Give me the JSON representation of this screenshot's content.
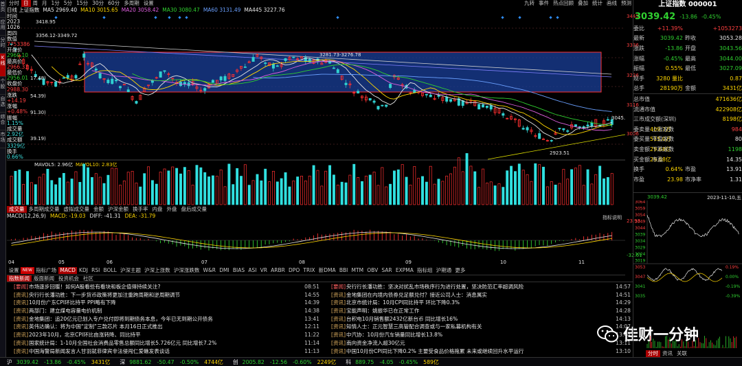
{
  "sidebar": [
    "首页",
    "应用",
    "分时",
    "K线",
    "个股",
    "自选",
    "综合",
    "市场"
  ],
  "topbar": [
    "分时",
    "日",
    "周",
    "月",
    "1分",
    "5分",
    "15分",
    "30分",
    "60分",
    "多周期",
    "设置"
  ],
  "topbar_right": [
    "九转",
    "事件",
    "热点回顾",
    "叠加",
    "统计",
    "画线",
    "预测"
  ],
  "chart_info": {
    "title": "日线 上证指数",
    "ma5": "MA5 2969.40",
    "ma10": "MA10 3015.65",
    "ma20": "MA20 3058.42",
    "ma30": "MA30 3080.47",
    "ma60": "MA60 3131.49",
    "ma445": "MA445 3227.76"
  },
  "left_info": [
    {
      "t": "时间",
      "c": "wht"
    },
    {
      "t": "2023",
      "c": "wht"
    },
    {
      "t": "1026",
      "c": "wht"
    },
    {
      "t": "周四",
      "c": "wht"
    },
    {
      "t": "数值",
      "c": "wht"
    },
    {
      "t": "7753386",
      "c": "red"
    },
    {
      "t": "开盘价",
      "c": "wht"
    },
    {
      "t": "2960.10",
      "c": "grn"
    },
    {
      "t": "最高价",
      "c": "wht"
    },
    {
      "t": "2966.33",
      "c": "red"
    },
    {
      "t": "最低价",
      "c": "wht"
    },
    {
      "t": "2956.01",
      "c": "grn"
    },
    {
      "t": "收盘价",
      "c": "wht"
    },
    {
      "t": "2988.30",
      "c": "red"
    },
    {
      "t": "涨跌",
      "c": "wht"
    },
    {
      "t": "+14.19",
      "c": "red"
    },
    {
      "t": "涨幅",
      "c": "wht"
    },
    {
      "t": "+0.48%",
      "c": "red"
    },
    {
      "t": "振幅",
      "c": "wht"
    },
    {
      "t": "1.15%",
      "c": "cyn"
    },
    {
      "t": "成交量",
      "c": "wht"
    },
    {
      "t": "2.92亿",
      "c": "cyn"
    },
    {
      "t": "成交额",
      "c": "wht"
    },
    {
      "t": "3329亿",
      "c": "cyn"
    },
    {
      "t": "换手",
      "c": "wht"
    },
    {
      "t": "0.66%",
      "c": "cyn"
    }
  ],
  "price_axis": [
    "3445",
    "3336",
    "3226",
    "3116",
    "3006"
  ],
  "price_labels": {
    "high": "3418.95",
    "box_left": "3356.12-3349.72",
    "box_right": "3281.73-3276.78",
    "low": "2923.51",
    "last": "3045.",
    "l1": "17.48)",
    "l2": "54.39)",
    "l3": "91.30)",
    "l4": "39.19)"
  },
  "volume": {
    "label": "MAVOL5: 2.96亿 MAVOL10: 2.83亿",
    "mavol5": "MAVOL5: 2.96亿",
    "mavol10": "MAVOL10: 2.83亿",
    "axis": [
      "573.01万",
      "289.59万",
      "X100"
    ]
  },
  "indicator_tabs": [
    "成交量",
    "多周期成交量",
    "虚拟成交量",
    "金额",
    "沪深金额",
    "换手率",
    "内盘",
    "外盘",
    "盘后成交量"
  ],
  "macd": {
    "title": "MACD(12,26,9)",
    "macd": "MACD: -19.03",
    "diff": "DIFF: -41.31",
    "dea": "DEA: -31.79",
    "axis_top": "23.93",
    "axis_bottom": "-32.61",
    "note": "指标说明"
  },
  "month_labels": [
    "04",
    "05",
    "06",
    "07",
    "08",
    "09",
    "10",
    "11"
  ],
  "bottom_tabs": [
    "设置",
    "NEW",
    "指标广场",
    "MACD",
    "KDJ",
    "RSI",
    "BOLL",
    "沪深主题",
    "沪深上涨数",
    "沪深涨跌数",
    "W&R",
    "DMI",
    "BIAS",
    "ASI",
    "VR",
    "ARBR",
    "DPO",
    "TRIX",
    "新DMA",
    "BBI",
    "MTM",
    "OBV",
    "SAR",
    "EXPMA",
    "指标组",
    "沪期通",
    "更多"
  ],
  "news_tabs": [
    "指数新闻",
    "版面新闻",
    "投资机会",
    "社区"
  ],
  "news_left": [
    {
      "cat": "[要闻]",
      "title": "市场逐步回暖！如何A股看些有看块和板企值得持续关注?",
      "time": "08:51"
    },
    {
      "cat": "[资讯]",
      "title": "央行行长潘功胜：下一步货币政策将更加注重跨周期和逆周期调节",
      "time": "14:55"
    },
    {
      "cat": "[资讯]",
      "title": "10月份广东CPI环比持平 PPI略有下降",
      "time": "14:39"
    },
    {
      "cat": "[资讯]",
      "title": "两部门：建立煤电容量电价机制",
      "time": "14:38"
    },
    {
      "cat": "[资讯]",
      "title": "金地集团：追20亿元已划入专户兑付即将到期债务本息，今年已无到期公开债务",
      "time": "13:41"
    },
    {
      "cat": "[资讯]",
      "title": "英伟达确认：将为中国“定制”三款芯片 本月16日正式推出",
      "time": "12:11"
    },
    {
      "cat": "[资讯]",
      "title": "2023年10月，北京CPI环比由涨转降、同比持平",
      "time": "11:22"
    },
    {
      "cat": "[资讯]",
      "title": "国家统计局：1-10月全国社会消费品零售总额同比增长5.726亿元 同比增长7.2%",
      "time": "11:14"
    },
    {
      "cat": "[资讯]",
      "title": "中国海警局新闻发言人甘羽就菲律宾非法侵闯仁爱礁发表谈话",
      "time": "11:13"
    }
  ],
  "news_right": [
    {
      "cat": "[要闻]",
      "title": "央行行长潘功胜：坚决对扰乱市场秩序行为进行处置，坚决防范汇率超调风险",
      "time": "14:57"
    },
    {
      "cat": "[资讯]",
      "title": "金地集团在内境内债券兑足额兑付？接近公司人士：消息属实",
      "time": "14:51"
    },
    {
      "cat": "[资讯]",
      "title": "北京市统计局：10月CPI同比持平 环比下降0.3%",
      "time": "14:29"
    },
    {
      "cat": "[资讯]",
      "title": "宝能声明：姚振华已在正常工作",
      "time": "14:28"
    },
    {
      "cat": "[资讯]",
      "title": "台积电10月销售额2432亿新台币 同比增长16%",
      "time": "14:13"
    },
    {
      "cat": "[资讯]",
      "title": "知情人士：正元智慧三高管配合调查或与一家私募机构有关",
      "time": "14:07"
    },
    {
      "cat": "[资讯]",
      "title": "中汽协：10月份汽车销量同比增长13.8%",
      "time": "13:44"
    },
    {
      "cat": "[资讯]",
      "title": "南向资金净流入超30亿元",
      "time": "13:11"
    },
    {
      "cat": "[资讯]",
      "title": "中国10月份CPI同比下降0.2% 主要受食品价格拖累 未来或继续回升水平运行",
      "time": "13:10"
    }
  ],
  "watermark": "佳财一分钟",
  "right_panel": {
    "title": "上证指数 000001",
    "price": "3039.42",
    "change": "-13.86",
    "pct": "-0.45%",
    "rows": [
      {
        "k": "委比",
        "v1": "+11.39%",
        "c1": "red",
        "k2": "",
        "v2": "+1053273",
        "c2": "red"
      },
      {
        "k": "最新",
        "v1": "3039.42",
        "c1": "grn",
        "k2": "昨收",
        "v2": "3053.28",
        "c2": "wht"
      },
      {
        "k": "涨跌",
        "v1": "-13.86",
        "c1": "grn",
        "k2": "开盘",
        "v2": "3043.56",
        "c2": "grn"
      },
      {
        "k": "涨幅",
        "v1": "-0.45%",
        "c1": "grn",
        "k2": "最高",
        "v2": "3044.00",
        "c2": "grn"
      },
      {
        "k": "振幅",
        "v1": "0.55%",
        "c1": "yel",
        "k2": "最低",
        "v2": "3027.09",
        "c2": "grn"
      },
      {
        "k": "现手",
        "v1": "3280 量比",
        "c1": "yel",
        "k2": "",
        "v2": "0.87",
        "c2": "yel"
      },
      {
        "k": "总手",
        "v1": "28190万",
        "c1": "yel",
        "k2": "金额",
        "v2": "3431亿",
        "c2": "yel"
      },
      {
        "k": "总市值",
        "v1": "",
        "c1": "wht",
        "k2": "",
        "v2": "471636亿",
        "c2": "yel"
      },
      {
        "k": "流通市值",
        "v1": "",
        "c1": "wht",
        "k2": "",
        "v2": "422908亿",
        "c2": "yel"
      },
      {
        "k": "三市成交额(深圳)",
        "v1": "",
        "c1": "wht",
        "k2": "",
        "v2": "8198亿",
        "c2": "yel"
      },
      {
        "k": "委卖量",
        "v1": "409.7万",
        "c1": "yel",
        "k2": "上涨家数",
        "v2": "984",
        "c2": "red"
      },
      {
        "k": "委买量",
        "v1": "515.0万",
        "c1": "yel",
        "k2": "平盘家数",
        "v2": "80",
        "c2": "wht"
      },
      {
        "k": "卖金额",
        "v1": "29.68亿",
        "c1": "yel",
        "k2": "下跌家数",
        "v2": "1198",
        "c2": "grn"
      },
      {
        "k": "买金额",
        "v1": "29.68亿",
        "c1": "yel",
        "k2": "市盈",
        "v2": "14.35",
        "c2": "wht"
      },
      {
        "k": "换手",
        "v1": "0.64%",
        "c1": "yel",
        "k2": "市盈",
        "v2": "13.91",
        "c2": "wht"
      },
      {
        "k": "市盈",
        "v1": "23.98",
        "c1": "yel",
        "k2": "市净率",
        "v2": "1.31",
        "c2": "wht"
      }
    ],
    "mini_title": "3039.42",
    "mini_date": "2023-11-10,五",
    "mini_axis_left": [
      "3064",
      "3059",
      "3054",
      "3049",
      "3044",
      "3039",
      "3034",
      "3029",
      "3024",
      "3019"
    ],
    "mini_axis_left2": [
      "3053",
      "3047",
      "3041",
      "3035"
    ],
    "mini_axis_right": [
      "0.19%",
      "0.00%",
      "-0.19%",
      "-0.39%"
    ],
    "mini_tabs": [
      "分时",
      "资讯",
      "关联"
    ]
  },
  "bottombar": [
    {
      "t": "沪",
      "c": "wht"
    },
    {
      "t": "3039.42",
      "c": "grn"
    },
    {
      "t": "-13.86",
      "c": "grn"
    },
    {
      "t": "-0.45%",
      "c": "grn"
    },
    {
      "t": "3431亿",
      "c": "yel"
    },
    {
      "t": "深",
      "c": "wht"
    },
    {
      "t": "9881.62",
      "c": "grn"
    },
    {
      "t": "-50.47",
      "c": "grn"
    },
    {
      "t": "-0.50%",
      "c": "grn"
    },
    {
      "t": "4744亿",
      "c": "yel"
    },
    {
      "t": "创",
      "c": "wht"
    },
    {
      "t": "2005.82",
      "c": "grn"
    },
    {
      "t": "-12.56",
      "c": "grn"
    },
    {
      "t": "-0.60%",
      "c": "grn"
    },
    {
      "t": "2249亿",
      "c": "yel"
    },
    {
      "t": "科",
      "c": "wht"
    },
    {
      "t": "889.75",
      "c": "grn"
    },
    {
      "t": "-4.05",
      "c": "grn"
    },
    {
      "t": "-0.45%",
      "c": "grn"
    },
    {
      "t": "589亿",
      "c": "yel"
    }
  ]
}
